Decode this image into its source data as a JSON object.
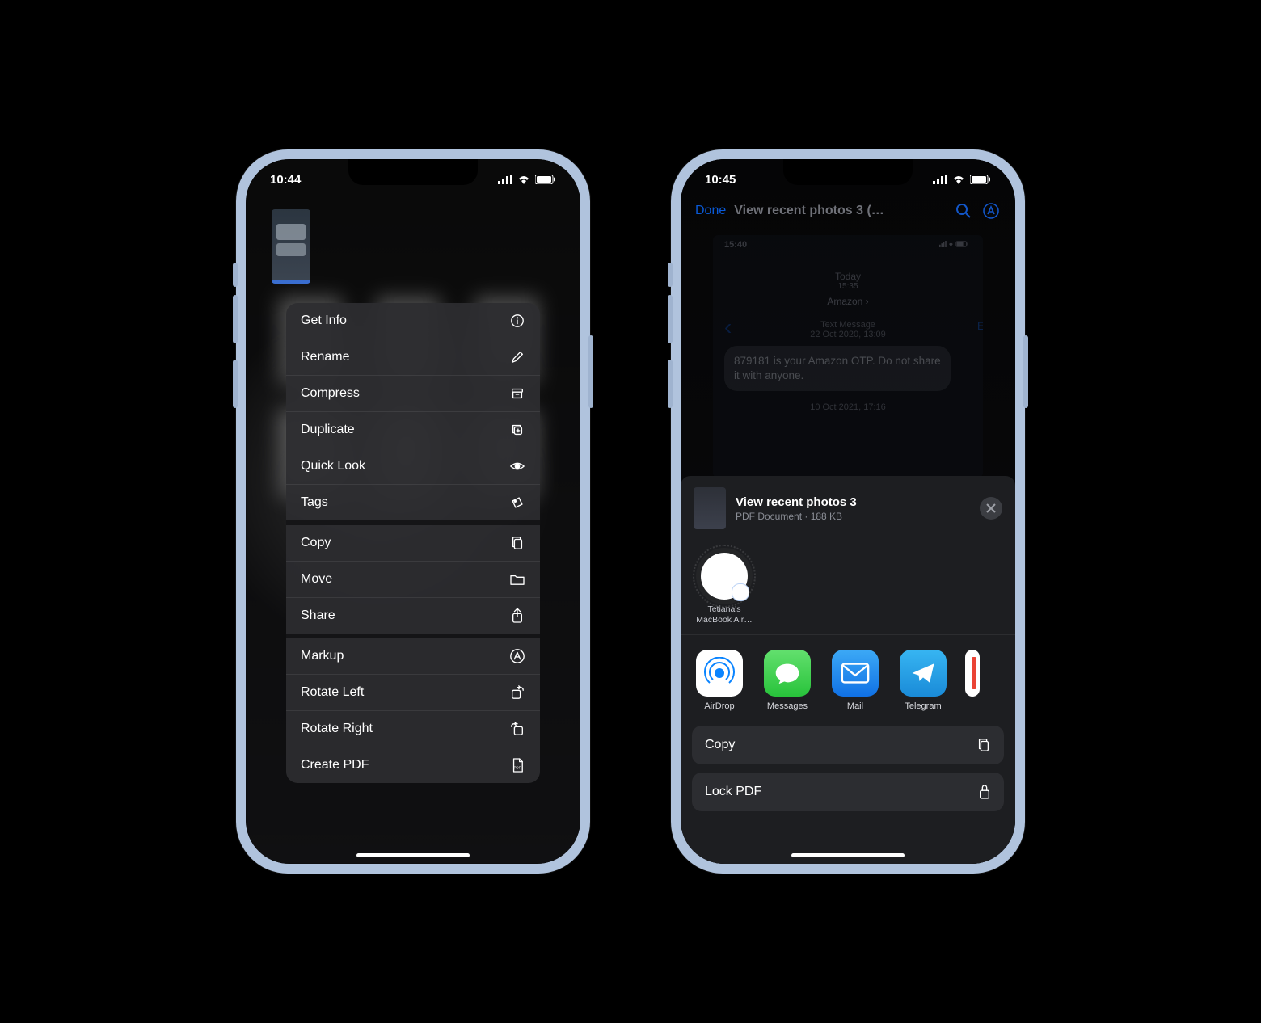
{
  "left": {
    "status_time": "10:44",
    "context_menu": {
      "groups": [
        [
          {
            "label": "Get Info",
            "icon": "info-icon"
          },
          {
            "label": "Rename",
            "icon": "pencil-icon"
          },
          {
            "label": "Compress",
            "icon": "archive-icon"
          },
          {
            "label": "Duplicate",
            "icon": "duplicate-icon"
          },
          {
            "label": "Quick Look",
            "icon": "eye-icon"
          },
          {
            "label": "Tags",
            "icon": "tag-icon"
          }
        ],
        [
          {
            "label": "Copy",
            "icon": "copy-docs-icon"
          },
          {
            "label": "Move",
            "icon": "folder-icon"
          },
          {
            "label": "Share",
            "icon": "share-icon"
          }
        ],
        [
          {
            "label": "Markup",
            "icon": "markup-icon"
          },
          {
            "label": "Rotate Left",
            "icon": "rotate-left-icon"
          },
          {
            "label": "Rotate Right",
            "icon": "rotate-right-icon"
          },
          {
            "label": "Create PDF",
            "icon": "pdf-icon"
          }
        ]
      ]
    }
  },
  "right": {
    "status_time": "10:45",
    "nav": {
      "done": "Done",
      "title": "View recent photos 3 (…"
    },
    "preview": {
      "clock": "15:40",
      "today": "Today",
      "today_time": "15:35",
      "sender": "Amazon",
      "text_message_label": "Text Message",
      "msg_date": "22 Oct 2020, 13:09",
      "bubble": "879181 is your Amazon OTP. Do not share it with anyone.",
      "date2": "10 Oct 2021, 17:16",
      "edit": "Ed"
    },
    "sheet": {
      "title": "View recent photos 3",
      "subtitle": "PDF Document · 188 KB",
      "airdrop_target_line1": "Tetiana's",
      "airdrop_target_line2": "MacBook Air…",
      "apps": [
        {
          "label": "AirDrop",
          "class": "ic-airdrop",
          "icon": "airdrop-icon"
        },
        {
          "label": "Messages",
          "class": "ic-messages",
          "icon": "messages-icon"
        },
        {
          "label": "Mail",
          "class": "ic-mail",
          "icon": "mail-icon"
        },
        {
          "label": "Telegram",
          "class": "ic-telegram",
          "icon": "telegram-icon"
        }
      ],
      "actions": [
        {
          "label": "Copy",
          "icon": "copy-docs-icon"
        },
        {
          "label": "Lock PDF",
          "icon": "lock-icon"
        }
      ]
    }
  }
}
